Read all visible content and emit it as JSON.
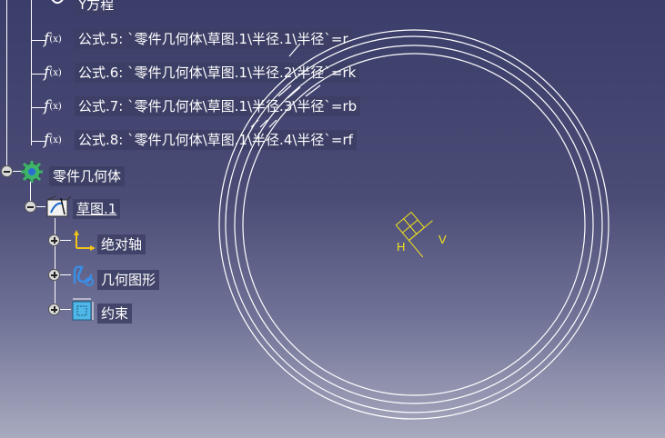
{
  "tree": {
    "top_item": {
      "label": "Y方程"
    },
    "formulas": [
      {
        "label": "公式.5: `零件几何体\\草图.1\\半径.1\\半径`=r"
      },
      {
        "label": "公式.6: `零件几何体\\草图.1\\半径.2\\半径`=rk"
      },
      {
        "label": "公式.7: `零件几何体\\草图.1\\半径.3\\半径`=rb"
      },
      {
        "label": "公式.8: `零件几何体\\草图.1\\半径.4\\半径`=rf"
      }
    ],
    "body": {
      "label": "零件几何体"
    },
    "sketch": {
      "label": "草图.1"
    },
    "sketch_children": [
      {
        "label": "绝对轴"
      },
      {
        "label": "几何图形"
      },
      {
        "label": "约束"
      }
    ]
  },
  "viewport": {
    "axis_h": "H",
    "axis_v": "V",
    "curve_color": "#ffffff",
    "axis_color": "#f3e31a"
  }
}
